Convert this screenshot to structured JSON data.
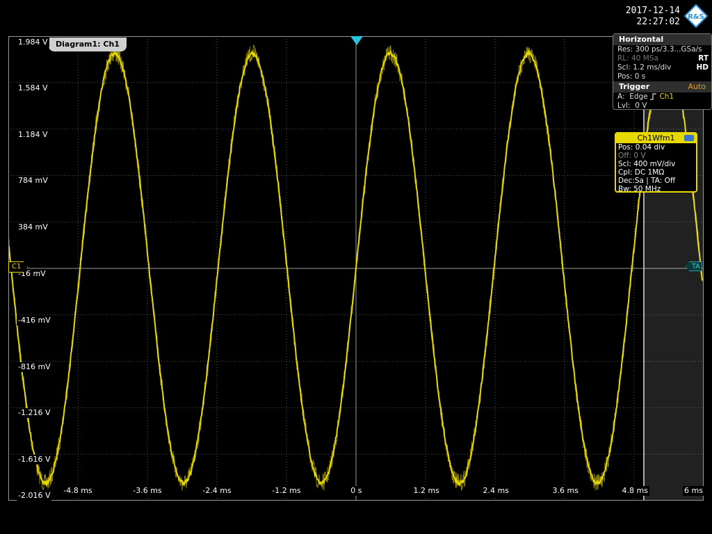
{
  "header": {
    "date": "2017-12-14",
    "time": "22:27:02",
    "logo": "R&S"
  },
  "diagram_tab": "Diagram1: Ch1",
  "y_axis_labels": [
    "1.984 V",
    "1.584 V",
    "1.184 V",
    "784 mV",
    "384 mV",
    "-16 mV",
    "-416 mV",
    "-816 mV",
    "-1.216 V",
    "-1.616 V",
    "-2.016 V"
  ],
  "x_axis_labels": [
    "-4.8 ms",
    "-3.6 ms",
    "-2.4 ms",
    "-1.2 ms",
    "0 s",
    "1.2 ms",
    "2.4 ms",
    "3.6 ms",
    "4.8 ms",
    "6 ms"
  ],
  "markers": {
    "channel": "C1",
    "ta": "TA"
  },
  "horizontal": {
    "title": "Horizontal",
    "res_label": "Res:",
    "res_value": "300 ps/3.3...GSa/s",
    "rl_label": "RL:",
    "rl_value": "40 MSa",
    "rt": "RT",
    "scl_label": "Scl:",
    "scl_value": "1.2 ms/div",
    "hd": "HD",
    "pos_label": "Pos:",
    "pos_value": "0 s"
  },
  "trigger": {
    "title": "Trigger",
    "mode": "Auto",
    "a_label": "A:",
    "a_type": "Edge",
    "a_source": "Ch1",
    "lvl_label": "Lvl:",
    "lvl_value": "0 V"
  },
  "waveform_box": {
    "title": "Ch1Wfm1",
    "pos": "Pos: 0.04 div",
    "off": "Off: 0 V",
    "scl": "Scl: 400 mV/div",
    "cpl": "Cpl: DC 1MΩ",
    "dec": "Dec:Sa | TA: Off",
    "bw": "Bw: 50 MHz"
  },
  "colors": {
    "trace": "#e6d800",
    "grid": "#5a5a5a",
    "trigger_marker": "#27c4e0",
    "ta_marker": "#3fc7c7"
  },
  "waveform": {
    "frequency_hz": 420,
    "amplitude_v": 1.85,
    "offset_v": 0,
    "vertical_scale_v_per_div": 0.4,
    "time_scale_ms_per_div": 1.2
  }
}
